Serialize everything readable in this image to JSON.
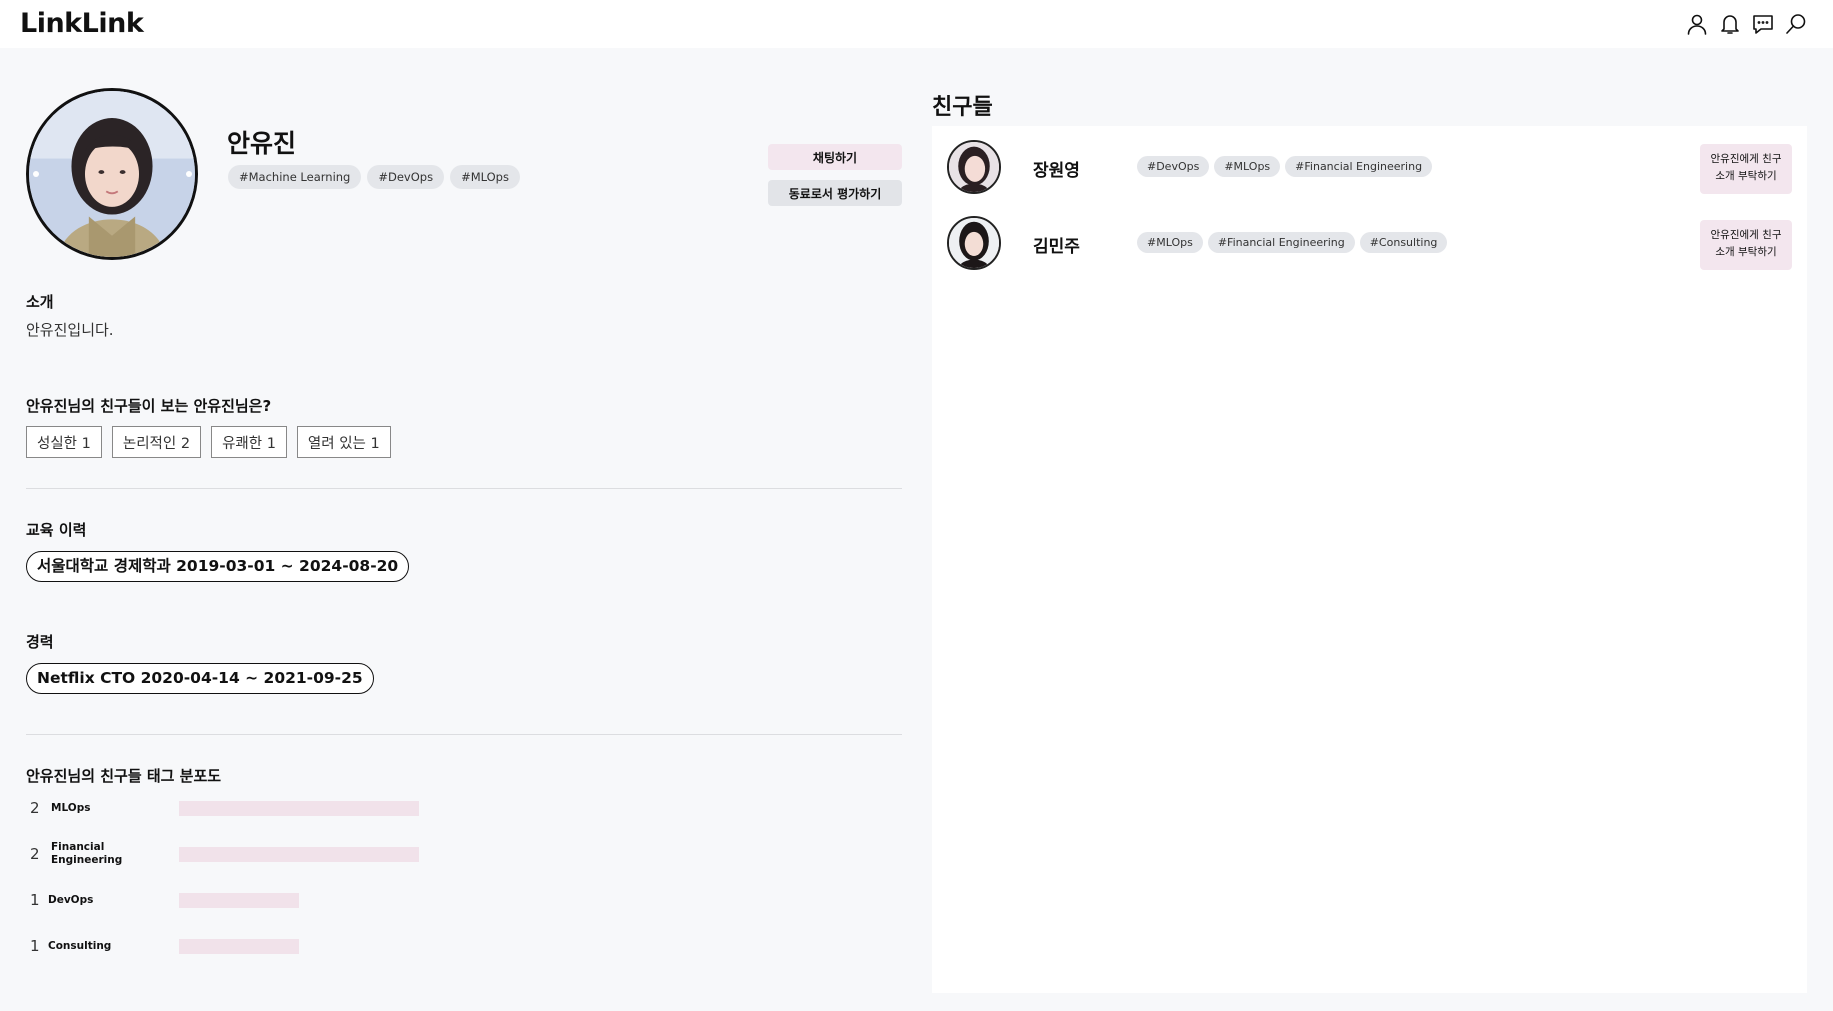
{
  "header": {
    "logo": "LinkLink"
  },
  "icons": {
    "profile": "user-icon",
    "notifications": "bell-icon",
    "messages": "chat-icon",
    "search": "search-icon"
  },
  "profile": {
    "name": "안유진",
    "tags": [
      "#Machine Learning",
      "#DevOps",
      "#MLOps"
    ],
    "chat_button": "채팅하기",
    "evaluate_button": "동료로서 평가하기"
  },
  "intro": {
    "title": "소개",
    "text": "안유진입니다."
  },
  "traits": {
    "title": "안유진님의 친구들이 보는 안유진님은?",
    "items": [
      "성실한 1",
      "논리적인 2",
      "유쾌한 1",
      "열려 있는 1"
    ]
  },
  "education": {
    "title": "교육 이력",
    "items": [
      "서울대학교 경제학과 2019-03-01 ~ 2024-08-20"
    ]
  },
  "career": {
    "title": "경력",
    "items": [
      "Netflix CTO 2020-04-14 ~ 2021-09-25"
    ]
  },
  "distribution": {
    "title": "안유진님의 친구들 태그 분포도",
    "items": [
      {
        "count": "2",
        "label": "MLOps",
        "value": 2
      },
      {
        "count": "2",
        "label": "Financial Engineering",
        "value": 2
      },
      {
        "count": "1",
        "label": "DevOps",
        "value": 1
      },
      {
        "count": "1",
        "label": "Consulting",
        "value": 1
      }
    ]
  },
  "friends": {
    "title": "친구들",
    "items": [
      {
        "name": "장원영",
        "tags": [
          "#DevOps",
          "#MLOps",
          "#Financial Engineering"
        ],
        "button": "안유진에게 친구\n소개 부탁하기"
      },
      {
        "name": "김민주",
        "tags": [
          "#MLOps",
          "#Financial Engineering",
          "#Consulting"
        ],
        "button": "안유진에게 친구\n소개 부탁하기"
      }
    ]
  },
  "colors": {
    "background": "#f7f8fa",
    "tag_background": "#e4e6ea",
    "accent_pink": "#f3e6ee",
    "bar_pink": "#f1e2ea"
  }
}
